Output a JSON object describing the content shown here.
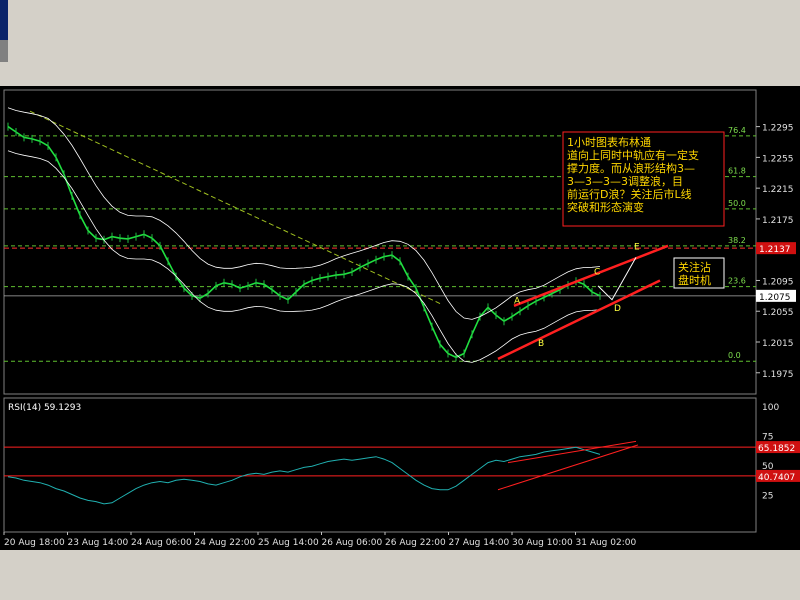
{
  "chart_data": [
    {
      "type": "line",
      "panel": "price",
      "instrument_note": "1小时图表布林通道向上同时中轨应有一定支撑力度。而从浪形结构3—3—3—3—3调整浪，目前运行D浪？关注后市L线突破和形态演变",
      "ylim": [
        1.195,
        1.234
      ],
      "y_ticks": [
        "1.2295",
        "1.2255",
        "1.2215",
        "1.2175",
        "1.2135",
        "1.2095",
        "1.2055",
        "1.2015",
        "1.1975"
      ],
      "current_price": "1.2075",
      "highlight_price": "1.2137",
      "fib_levels": [
        {
          "label": "76.4",
          "value": 1.2283
        },
        {
          "label": "61.8",
          "value": 1.223
        },
        {
          "label": "50.0",
          "value": 1.2188
        },
        {
          "label": "38.2",
          "value": 1.214
        },
        {
          "label": "23.6",
          "value": 1.2087
        },
        {
          "label": "0.0",
          "value": 1.199
        }
      ],
      "wave_labels": [
        "A",
        "B",
        "C",
        "D",
        "E"
      ],
      "side_note": "关注沾\n盘时机",
      "series": [
        {
          "values": [
            1.2295,
            1.2288,
            1.2281,
            1.2279,
            1.2276,
            1.227,
            1.2255,
            1.2233,
            1.2205,
            1.218,
            1.216,
            1.215,
            1.2148,
            1.2152,
            1.215,
            1.2149,
            1.2152,
            1.2155,
            1.215,
            1.214,
            1.212,
            1.21,
            1.2085,
            1.2075,
            1.2072,
            1.2078,
            1.2088,
            1.2092,
            1.209,
            1.2085,
            1.2088,
            1.2092,
            1.209,
            1.2083,
            1.2075,
            1.207,
            1.208,
            1.209,
            1.2095,
            1.2098,
            1.21,
            1.2102,
            1.2103,
            1.2106,
            1.2112,
            1.2117,
            1.2122,
            1.2126,
            1.2128,
            1.212,
            1.21,
            1.2085,
            1.206,
            1.2035,
            1.2012,
            1.2,
            1.1995,
            1.2,
            1.2025,
            1.2048,
            1.206,
            1.205,
            1.2042,
            1.2048,
            1.2055,
            1.2062,
            1.2068,
            1.2073,
            1.2078,
            1.2083,
            1.2089,
            1.2094,
            1.209,
            1.208,
            1.2075
          ]
        }
      ]
    },
    {
      "type": "line",
      "panel": "rsi",
      "title": "RSI(14) 59.1293",
      "ylim": [
        0,
        100
      ],
      "y_ticks": [
        "100",
        "75",
        "50",
        "25"
      ],
      "levels": [
        {
          "value": 65.1852,
          "label": "65.1852"
        },
        {
          "value": 40.7407,
          "label": "40.7407"
        }
      ],
      "categories": [
        "20 Aug 18:00",
        "23 Aug 14:00",
        "24 Aug 06:00",
        "24 Aug 22:00",
        "25 Aug 14:00",
        "26 Aug 06:00",
        "26 Aug 22:00",
        "27 Aug 14:00",
        "30 Aug 10:00",
        "31 Aug 02:00"
      ],
      "series": [
        {
          "values": [
            40,
            39,
            37,
            36,
            35,
            33,
            30,
            28,
            25,
            22,
            20,
            19,
            17,
            18,
            22,
            26,
            30,
            33,
            35,
            36,
            35,
            37,
            38,
            37,
            36,
            34,
            33,
            35,
            37,
            40,
            42,
            43,
            42,
            44,
            45,
            44,
            46,
            48,
            49,
            51,
            53,
            54,
            55,
            54,
            55,
            56,
            57,
            55,
            52,
            47,
            42,
            37,
            33,
            30,
            29,
            29,
            32,
            37,
            42,
            47,
            52,
            54,
            53,
            55,
            57,
            58,
            59,
            61,
            62,
            63,
            64,
            65,
            63,
            61,
            59
          ]
        }
      ]
    }
  ]
}
